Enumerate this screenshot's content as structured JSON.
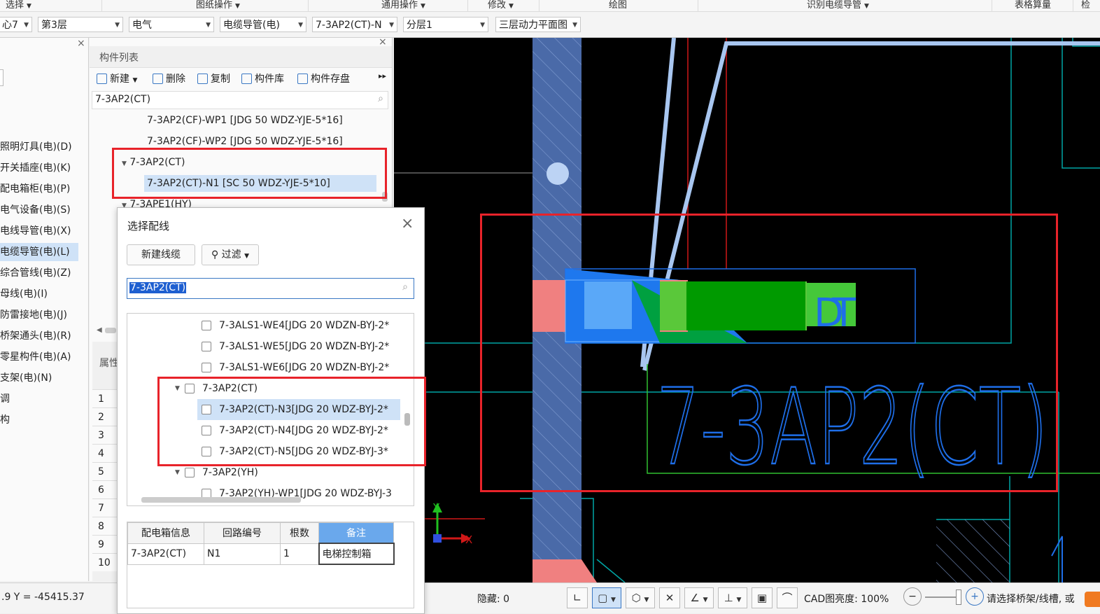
{
  "ribbon": {
    "select": "选择",
    "drawing_ops": "图纸操作",
    "general_ops": "通用操作",
    "modify": "修改",
    "draw": "绘图",
    "identify_cable_conduit": "识别电缆导管",
    "table_calc": "表格算量",
    "check": "检"
  },
  "selectors": {
    "center": "心7",
    "floor": "第3层",
    "discipline": "电气",
    "type": "电缆导管(电)",
    "component": "7-3AP2(CT)-N",
    "layer": "分层1",
    "plan": "三层动力平面图"
  },
  "left_nav": {
    "items": [
      "照明灯具(电)(D)",
      "开关插座(电)(K)",
      "配电箱柜(电)(P)",
      "电气设备(电)(S)",
      "电线导管(电)(X)",
      "电缆导管(电)(L)",
      "综合管线(电)(Z)",
      "母线(电)(I)",
      "防雷接地(电)(J)",
      "桥架通头(电)(R)",
      "零星构件(电)(A)",
      "支架(电)(N)",
      "调",
      "构"
    ],
    "active_index": 5
  },
  "comp_list": {
    "title": "构件列表",
    "toolbar": {
      "new": "新建",
      "delete": "删除",
      "copy": "复制",
      "library": "构件库",
      "save": "构件存盘"
    },
    "search_value": "7-3AP2(CT)",
    "items": [
      "7-3AP2(CF)-WP1 [JDG 50 WDZ-YJE-5*16]",
      "7-3AP2(CF)-WP2 [JDG 50 WDZ-YJE-5*16]",
      "7-3AP2(CT)",
      "7-3AP2(CT)-N1 [SC 50 WDZ-YJE-5*10]",
      "7-3APE1(HY)"
    ],
    "props_label": "属性",
    "row_numbers": [
      "1",
      "2",
      "3",
      "4",
      "5",
      "6",
      "7",
      "8",
      "9",
      "10"
    ]
  },
  "dialog": {
    "title": "选择配线",
    "new_cable": "新建线缆",
    "filter": "过滤",
    "search_value": "7-3AP2(CT)",
    "tree": [
      {
        "label": "7-3ALS1-WE4[JDG 20 WDZN-BYJ-2*",
        "level": 1
      },
      {
        "label": "7-3ALS1-WE5[JDG 20 WDZN-BYJ-2*",
        "level": 1
      },
      {
        "label": "7-3ALS1-WE6[JDG 20 WDZN-BYJ-2*",
        "level": 1
      },
      {
        "label": "7-3AP2(CT)",
        "level": 0
      },
      {
        "label": "7-3AP2(CT)-N3[JDG 20 WDZ-BYJ-2*",
        "level": 1
      },
      {
        "label": "7-3AP2(CT)-N4[JDG 20 WDZ-BYJ-2*",
        "level": 1
      },
      {
        "label": "7-3AP2(CT)-N5[JDG 20 WDZ-BYJ-3*",
        "level": 1
      },
      {
        "label": "7-3AP2(YH)",
        "level": 0
      },
      {
        "label": "7-3AP2(YH)-WP1[JDG 20 WDZ-BYJ-3",
        "level": 1
      }
    ],
    "table": {
      "headers": [
        "配电箱信息",
        "回路编号",
        "根数",
        "备注"
      ],
      "row": [
        "7-3AP2(CT)",
        "N1",
        "1",
        "电梯控制箱"
      ]
    }
  },
  "cad": {
    "label_text": "7-3AP2(CT)",
    "dt_text": "DT",
    "axis_x": "X",
    "axis_y": "Y"
  },
  "status": {
    "coords": ".9 Y = -45415.37",
    "hidden": "隐藏: 0",
    "cad_brightness": "CAD图亮度: 100%",
    "hint": "请选择桥架/线槽, 或"
  },
  "colors": {
    "highlight_red": "#e8232a",
    "selection_blue": "#cfe2f7",
    "cad_cyan": "#00a6a6",
    "cad_blue": "#1e6ee8",
    "cad_green": "#00a000"
  }
}
